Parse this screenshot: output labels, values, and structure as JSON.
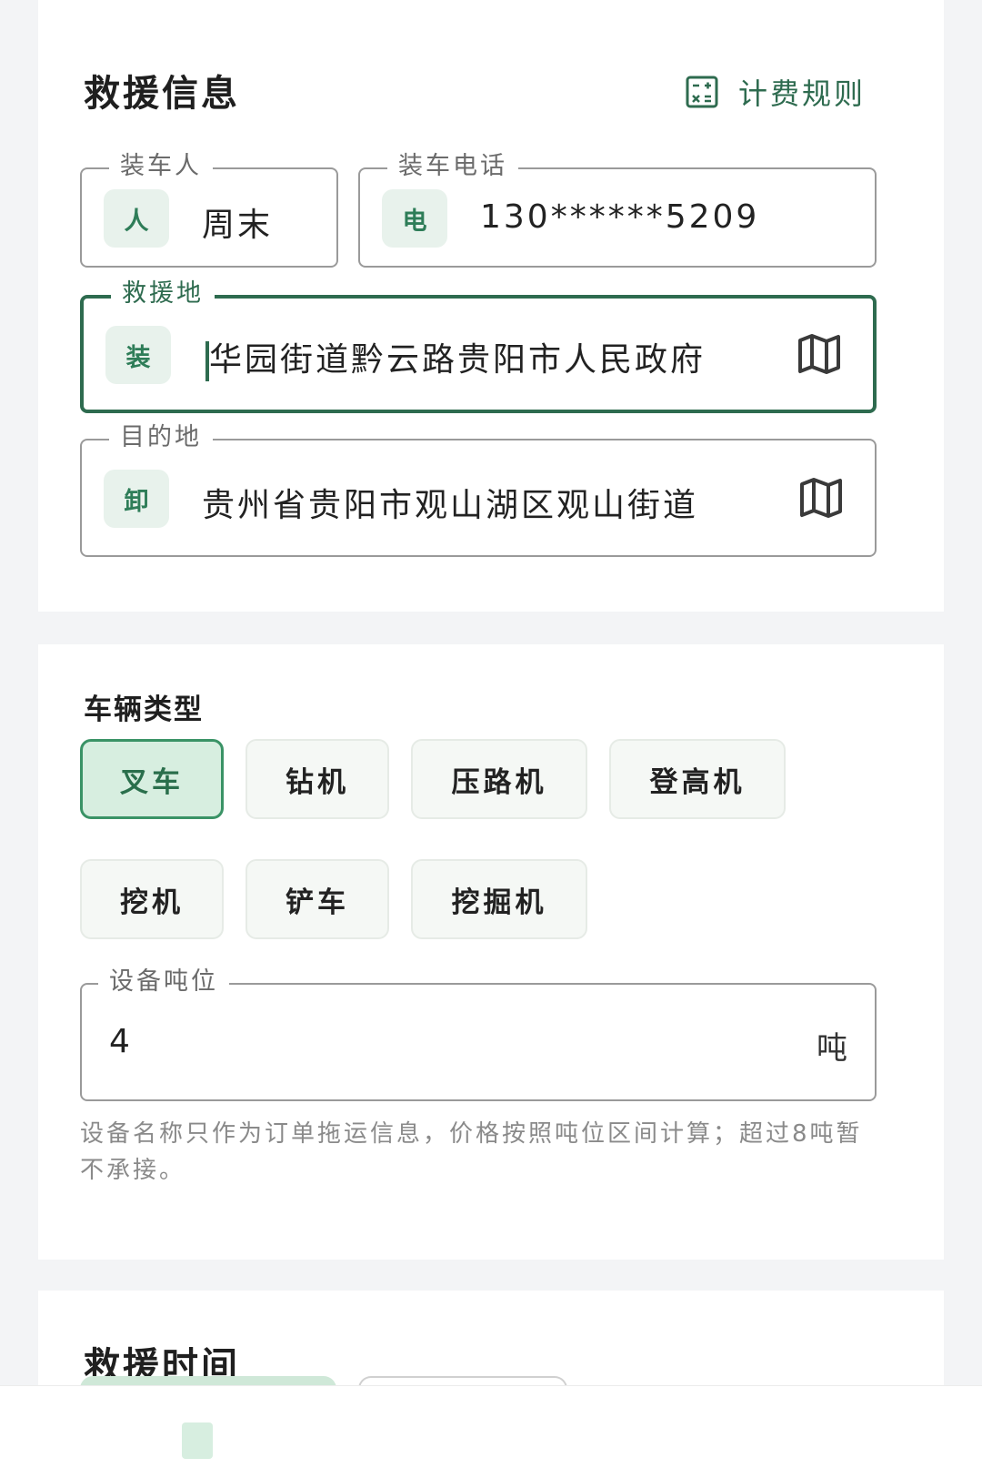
{
  "rescue_info": {
    "title": "救援信息",
    "fee_rule_label": "计费规则",
    "loader": {
      "label": "装车人",
      "badge": "人",
      "value": "周末"
    },
    "phone": {
      "label": "装车电话",
      "badge": "电",
      "value": "130******5209"
    },
    "origin": {
      "label": "救援地",
      "badge": "装",
      "value": "华园街道黔云路贵阳市人民政府"
    },
    "destination": {
      "label": "目的地",
      "badge": "卸",
      "value": "贵州省贵阳市观山湖区观山街道"
    }
  },
  "vehicle": {
    "title": "车辆类型",
    "types": [
      "叉车",
      "钻机",
      "压路机",
      "登高机",
      "挖机",
      "铲车",
      "挖掘机"
    ],
    "selected": "叉车",
    "tonnage": {
      "label": "设备吨位",
      "value": "4",
      "unit": "吨"
    },
    "hint": "设备名称只作为订单拖运信息，价格按照吨位区间计算；超过8吨暂不承接。"
  },
  "rescue_time": {
    "title": "救援时间"
  },
  "colors": {
    "brand_green": "#2e6b4f",
    "chip_selected_bg": "#d7eee0",
    "badge_bg": "#e8f2ec"
  },
  "icons": {
    "fee_rule": "calculator-icon",
    "map": "map-icon"
  }
}
